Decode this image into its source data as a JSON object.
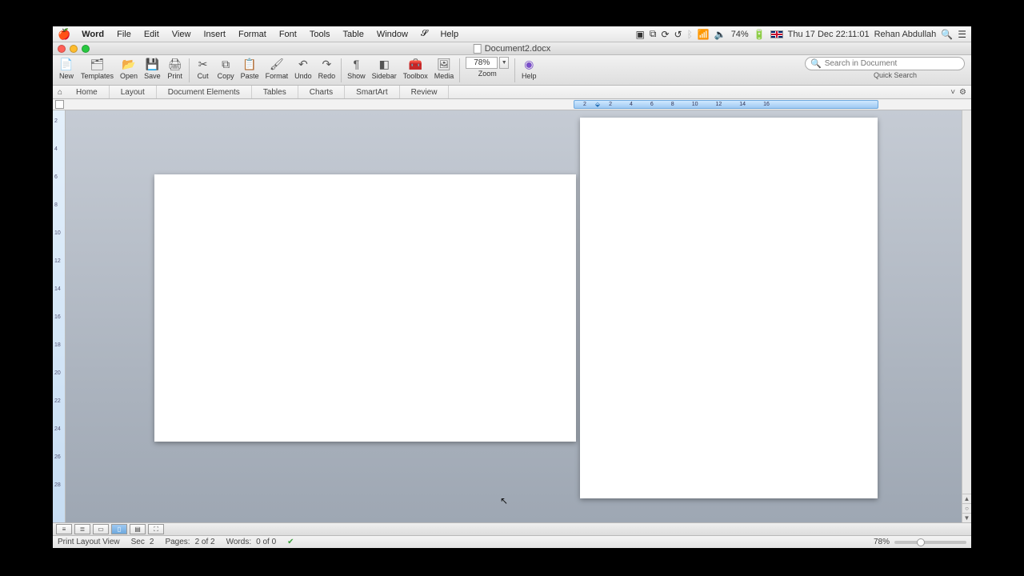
{
  "menubar": {
    "app": "Word",
    "items": [
      "File",
      "Edit",
      "View",
      "Insert",
      "Format",
      "Font",
      "Tools",
      "Table",
      "Window"
    ],
    "help": "Help",
    "battery": "74%",
    "clock": "Thu 17 Dec  22:11:01",
    "user": "Rehan Abdullah"
  },
  "titlebar": {
    "document": "Document2.docx"
  },
  "toolbar": {
    "buttons": [
      "New",
      "Templates",
      "Open",
      "Save",
      "Print",
      "Cut",
      "Copy",
      "Paste",
      "Format",
      "Undo",
      "Redo",
      "Show",
      "Sidebar",
      "Toolbox",
      "Media"
    ],
    "zoom_group_label": "Zoom",
    "zoom_value": "78%",
    "help": "Help",
    "search_placeholder": "Search in Document",
    "quick_search": "Quick Search"
  },
  "ribbon": {
    "tabs": [
      "Home",
      "Layout",
      "Document Elements",
      "Tables",
      "Charts",
      "SmartArt",
      "Review"
    ]
  },
  "ruler": {
    "marks": [
      "2",
      "2",
      "4",
      "6",
      "8",
      "10",
      "12",
      "14",
      "16"
    ]
  },
  "vruler": {
    "marks": [
      "2",
      "4",
      "6",
      "8",
      "10",
      "12",
      "14",
      "16",
      "18",
      "20",
      "22",
      "24",
      "26",
      "28"
    ]
  },
  "status": {
    "view_name": "Print Layout View",
    "sec_label": "Sec",
    "sec_val": "2",
    "pages_label": "Pages:",
    "pages_val": "2 of 2",
    "words_label": "Words:",
    "words_val": "0 of 0",
    "zoom": "78%"
  }
}
